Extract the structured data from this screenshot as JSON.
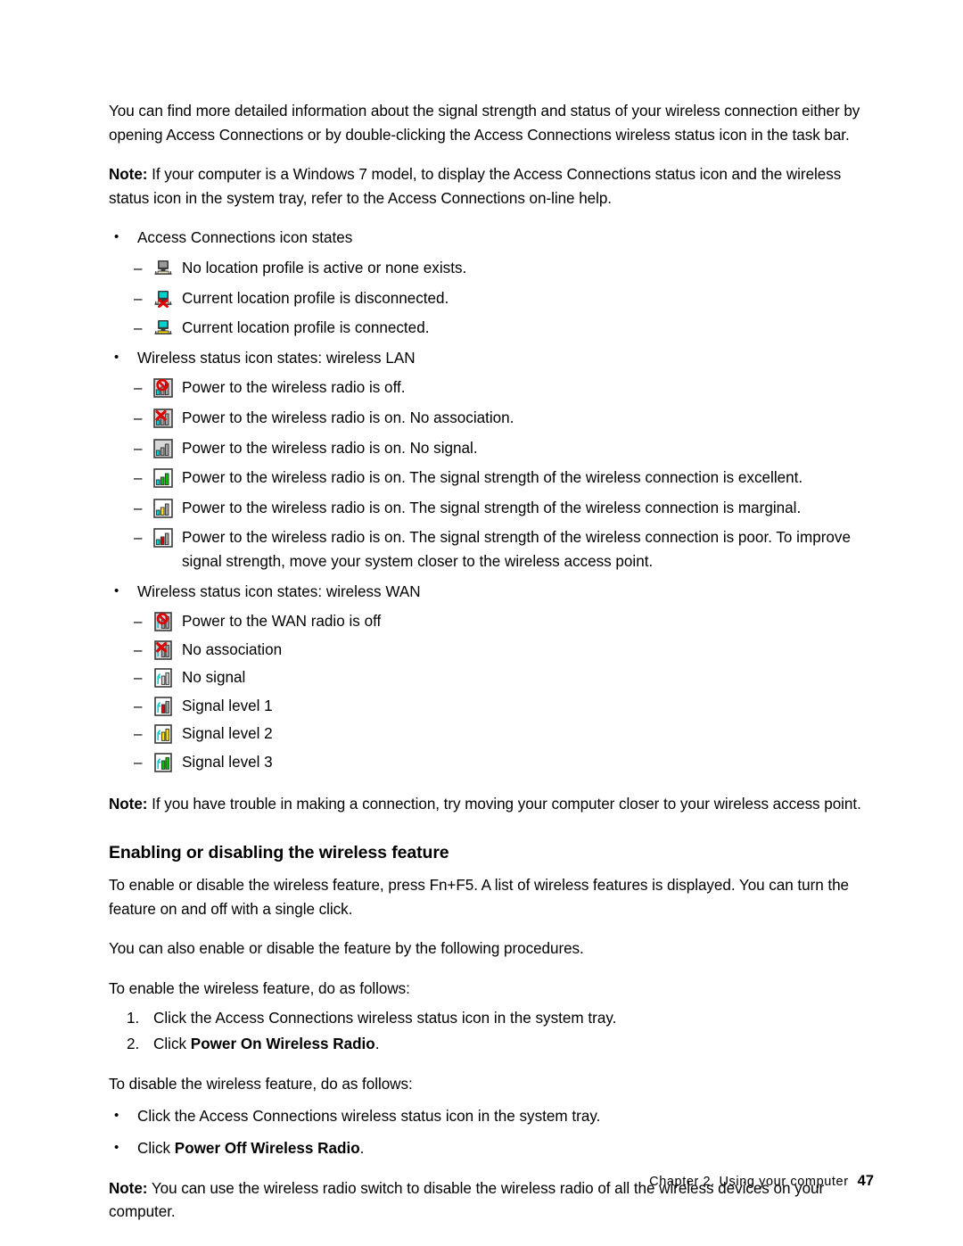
{
  "document": {
    "intro_paragraph": "You can find more detailed information about the signal strength and status of your wireless connection either by opening Access Connections or by double-clicking the Access Connections wireless status icon in the task bar.",
    "note1_label": "Note:",
    "note1_text": " If your computer is a Windows 7 model, to display the Access Connections status icon and the wireless status icon in the system tray, refer to the Access Connections on-line help.",
    "bullet_marker": "•",
    "dash_marker": "–"
  },
  "access_connections": {
    "heading": "Access Connections icon states",
    "items": [
      {
        "icon": "monitor-inactive-icon",
        "label": "No location profile is active or none exists."
      },
      {
        "icon": "monitor-disconnected-icon",
        "label": "Current location profile is disconnected."
      },
      {
        "icon": "monitor-connected-icon",
        "label": "Current location profile is connected."
      }
    ]
  },
  "wireless_lan": {
    "heading": "Wireless status icon states:  wireless LAN",
    "items": [
      {
        "icon": "lan-radio-off-icon",
        "label": "Power to the wireless radio is off."
      },
      {
        "icon": "lan-no-association-icon",
        "label": "Power to the wireless radio is on.  No association."
      },
      {
        "icon": "lan-no-signal-icon",
        "label": "Power to the wireless radio is on.  No signal."
      },
      {
        "icon": "lan-signal-excellent-icon",
        "label": "Power to the wireless radio is on.  The signal strength of the wireless connection is excellent."
      },
      {
        "icon": "lan-signal-marginal-icon",
        "label": "Power to the wireless radio is on.  The signal strength of the wireless connection is marginal."
      },
      {
        "icon": "lan-signal-poor-icon",
        "label": "Power to the wireless radio is on.  The signal strength of the wireless connection is poor.  To improve signal strength, move your system closer to the wireless access point."
      }
    ]
  },
  "wireless_wan": {
    "heading": "Wireless status icon states:  wireless WAN",
    "items": [
      {
        "icon": "wan-radio-off-icon",
        "label": "Power to the WAN radio is off"
      },
      {
        "icon": "wan-no-association-icon",
        "label": "No association"
      },
      {
        "icon": "wan-no-signal-icon",
        "label": "No signal"
      },
      {
        "icon": "wan-signal-1-icon",
        "label": "Signal level 1"
      },
      {
        "icon": "wan-signal-2-icon",
        "label": "Signal level 2"
      },
      {
        "icon": "wan-signal-3-icon",
        "label": "Signal level 3"
      }
    ]
  },
  "note2": {
    "label": "Note:",
    "text": " If you have trouble in making a connection, try moving your computer closer to your wireless access point."
  },
  "section": {
    "title": "Enabling or disabling the wireless feature",
    "intro": "To enable or disable the wireless feature, press Fn+F5.  A list of wireless features is displayed. You can turn the feature on and off with a single click.",
    "also": "You can also enable or disable the feature by the following procedures.",
    "enable_lead": "To enable the wireless feature, do as follows:",
    "enable_steps": [
      {
        "number": "1.",
        "text": "Click the Access Connections wireless status icon in the system tray.",
        "bold": ""
      },
      {
        "number": "2.",
        "prefix": "Click ",
        "bold": "Power On Wireless Radio",
        "suffix": "."
      }
    ],
    "disable_lead": "To disable the wireless feature, do as follows:",
    "disable_steps": [
      {
        "text": "Click the Access Connections wireless status icon in the system tray."
      },
      {
        "prefix": "Click ",
        "bold": "Power Off Wireless Radio",
        "suffix": "."
      }
    ]
  },
  "note3": {
    "label": "Note:",
    "text": " You can use the wireless radio switch to disable the wireless radio of all the wireless devices on your computer."
  },
  "footer": {
    "chapter": "Chapter 2.  Using your computer",
    "page": "47"
  },
  "colors": {
    "text": "#000000",
    "bar_green": "#00c000",
    "bar_yellow": "#ffe000",
    "bar_gray": "#a0a0a0",
    "bar_red": "#e00000",
    "screen_cyan": "#00d0d0",
    "screen_gray": "#9a9a9a",
    "frame": "#3a3a3a"
  }
}
